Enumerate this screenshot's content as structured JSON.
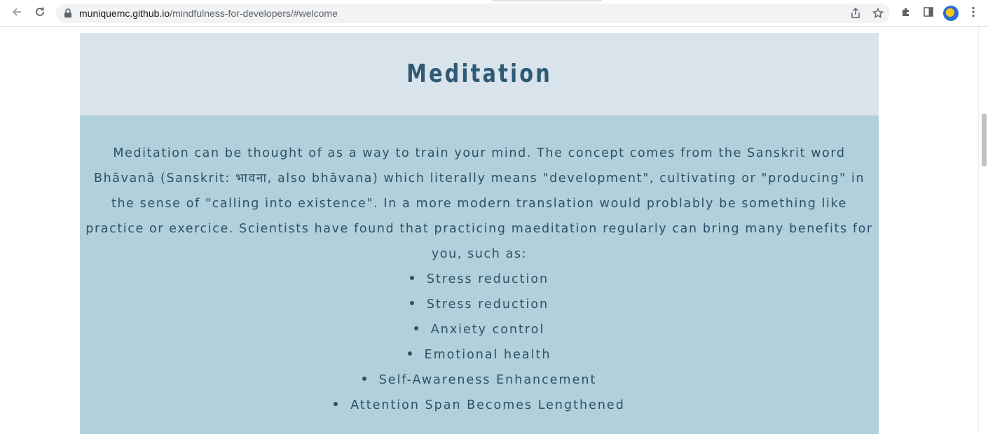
{
  "browser": {
    "url_host": "muniquemc.github.io",
    "url_path": "/mindfulness-for-developers/#welcome",
    "icons": {
      "back": "arrow-left-icon",
      "reload": "reload-icon",
      "lock": "lock-icon",
      "share": "share-icon",
      "bookmark": "star-icon",
      "extensions": "puzzle-icon",
      "sidepanel": "side-panel-icon",
      "profile": "avatar",
      "menu": "kebab-menu-icon"
    }
  },
  "section": {
    "title": "Meditation",
    "paragraph": "Meditation can be thought of as a way to train your mind. The concept comes from the Sanskrit word Bhāvanā (Sanskrit: भावना, also bhāvana) which literally means \"development\", cultivating or \"producing\" in the sense of \"calling into existence\". In a more modern translation would problably be something like practice or exercice. Scientists have found that practicing maeditation regularly can bring many benefits for you, such as:",
    "benefits": [
      "Stress reduction",
      "Stress reduction",
      "Anxiety control",
      "Emotional health",
      "Self-Awareness Enhancement",
      "Attention Span Becomes Lengthened"
    ]
  },
  "colors": {
    "header_band": "#d8e3ec",
    "body_band": "#b1d0db",
    "text": "#2b5268"
  }
}
